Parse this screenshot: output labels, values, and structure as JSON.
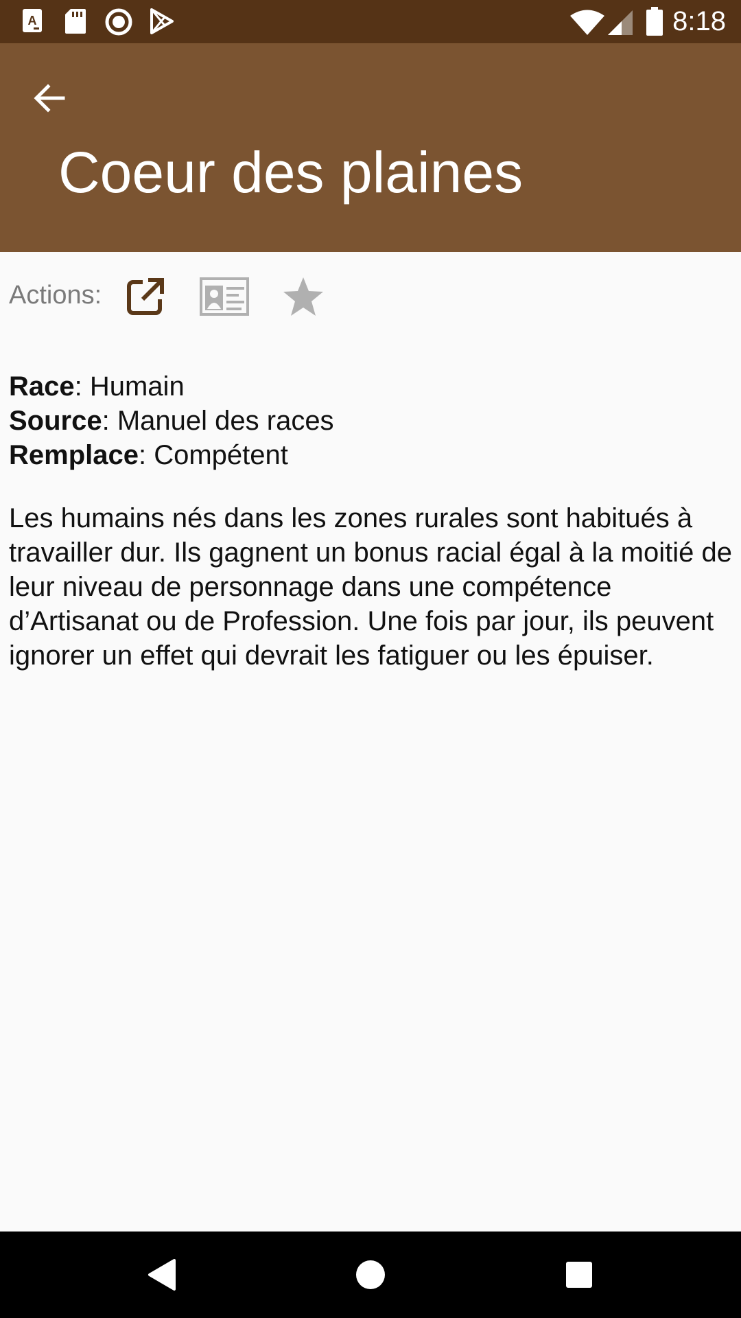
{
  "status_bar": {
    "time": "8:18",
    "left_icons": [
      "text-notification-icon",
      "sd-card-icon",
      "sync-circle-icon",
      "play-store-icon"
    ],
    "right_icons": [
      "wifi-icon",
      "cellular-signal-icon",
      "battery-icon"
    ]
  },
  "header": {
    "title": "Coeur des plaines",
    "background_color": "#7b5431",
    "status_color": "#553316"
  },
  "actions": {
    "label": "Actions:",
    "buttons": [
      {
        "icon": "external-link-icon",
        "color": "#5a3818"
      },
      {
        "icon": "id-card-icon",
        "color": "#b0b0b0"
      },
      {
        "icon": "star-icon",
        "color": "#b0b0b0"
      }
    ]
  },
  "details": {
    "race_label": "Race",
    "race_value": ": Humain",
    "source_label": "Source",
    "source_value": ": Manuel des races",
    "replaces_label": "Remplace",
    "replaces_value": ": Compétent"
  },
  "description": "Les humains nés dans les zones rurales sont habitués à travailler dur. Ils gagnent un bonus racial égal à la moitié de leur niveau de personnage dans une compétence d’Artisanat ou de Profession. Une fois par jour, ils peuvent ignorer un effet qui devrait les fatiguer ou les épuiser.",
  "nav_bar": {
    "buttons": [
      "back-triangle-icon",
      "home-circle-icon",
      "recents-square-icon"
    ]
  }
}
